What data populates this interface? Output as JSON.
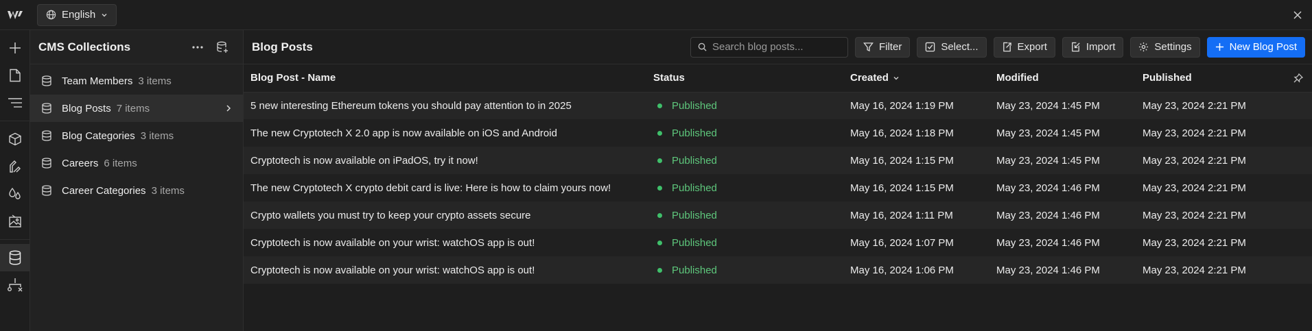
{
  "topbar": {
    "language": "English"
  },
  "panel": {
    "title": "CMS Collections",
    "collections": [
      {
        "name": "Team Members",
        "count": "3 items"
      },
      {
        "name": "Blog Posts",
        "count": "7 items"
      },
      {
        "name": "Blog Categories",
        "count": "3 items"
      },
      {
        "name": "Careers",
        "count": "6 items"
      },
      {
        "name": "Career Categories",
        "count": "3 items"
      }
    ]
  },
  "main": {
    "title": "Blog Posts",
    "search_placeholder": "Search blog posts...",
    "buttons": {
      "filter": "Filter",
      "select": "Select...",
      "export": "Export",
      "import": "Import",
      "settings": "Settings",
      "new": "New Blog Post"
    },
    "columns": {
      "name": "Blog Post - Name",
      "status": "Status",
      "created": "Created",
      "modified": "Modified",
      "published": "Published"
    },
    "rows": [
      {
        "name": "5 new interesting Ethereum tokens you should pay attention to in 2025",
        "status": "Published",
        "created": "May 16, 2024 1:19 PM",
        "modified": "May 23, 2024 1:45 PM",
        "published": "May 23, 2024 2:21 PM"
      },
      {
        "name": "The new Cryptotech X 2.0 app is now available on iOS and Android",
        "status": "Published",
        "created": "May 16, 2024 1:18 PM",
        "modified": "May 23, 2024 1:45 PM",
        "published": "May 23, 2024 2:21 PM"
      },
      {
        "name": "Cryptotech is now available on iPadOS, try it now!",
        "status": "Published",
        "created": "May 16, 2024 1:15 PM",
        "modified": "May 23, 2024 1:45 PM",
        "published": "May 23, 2024 2:21 PM"
      },
      {
        "name": "The new Cryptotech X crypto debit card is live: Here is how to claim yours now!",
        "status": "Published",
        "created": "May 16, 2024 1:15 PM",
        "modified": "May 23, 2024 1:46 PM",
        "published": "May 23, 2024 2:21 PM"
      },
      {
        "name": "Crypto wallets you must try to keep your crypto assets secure",
        "status": "Published",
        "created": "May 16, 2024 1:11 PM",
        "modified": "May 23, 2024 1:46 PM",
        "published": "May 23, 2024 2:21 PM"
      },
      {
        "name": "Cryptotech is now available on your wrist: watchOS app is out!",
        "status": "Published",
        "created": "May 16, 2024 1:07 PM",
        "modified": "May 23, 2024 1:46 PM",
        "published": "May 23, 2024 2:21 PM"
      },
      {
        "name": "Cryptotech is now available on your wrist: watchOS app is out!",
        "status": "Published",
        "created": "May 16, 2024 1:06 PM",
        "modified": "May 23, 2024 1:46 PM",
        "published": "May 23, 2024 2:21 PM"
      }
    ]
  },
  "colors": {
    "accent": "#146ef5",
    "status_published": "#3fbf6a"
  }
}
